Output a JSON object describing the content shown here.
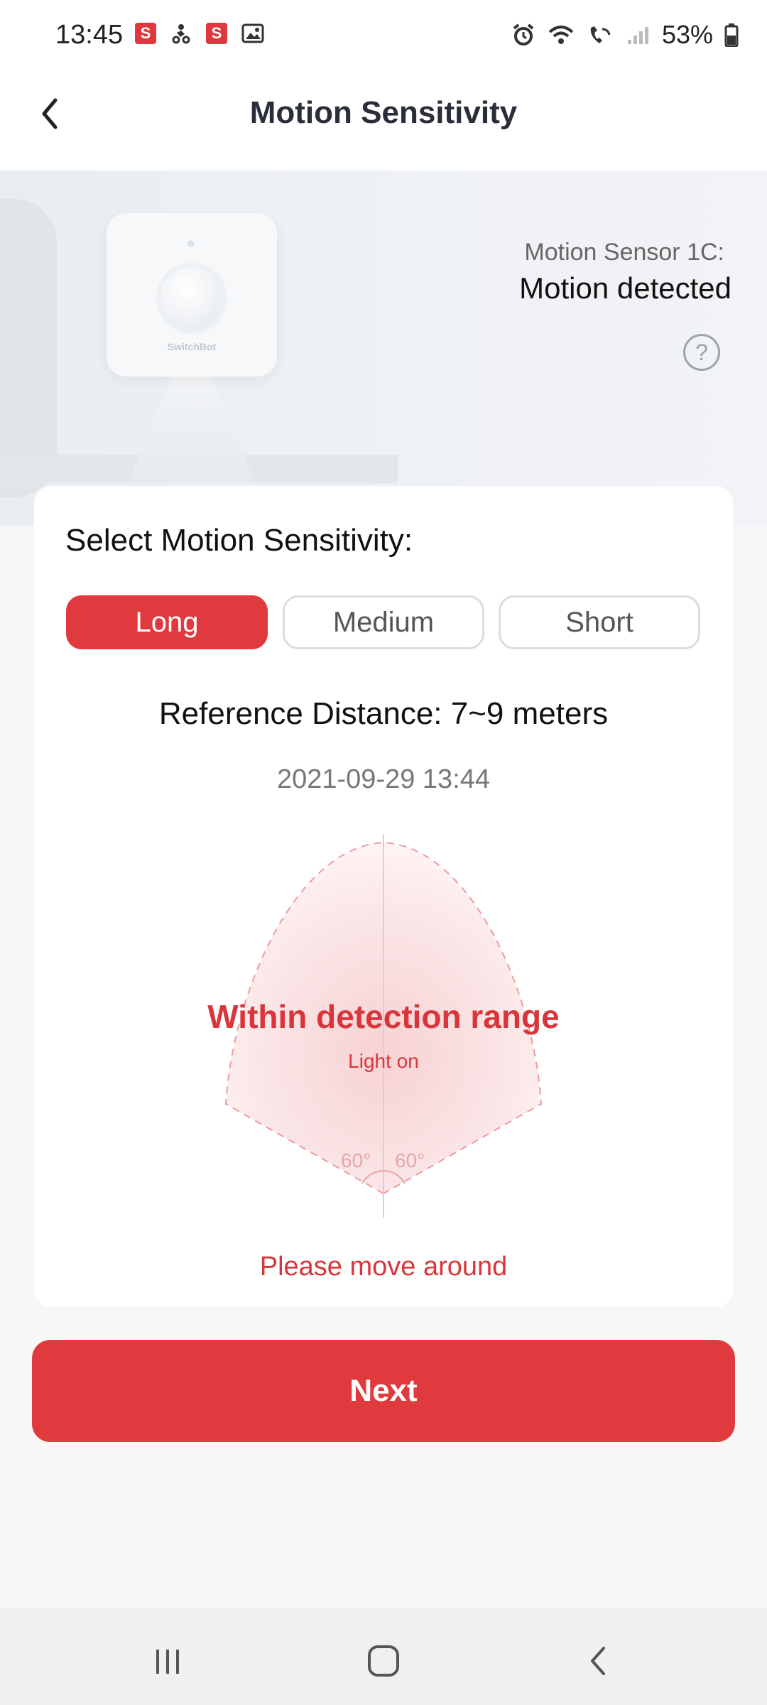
{
  "status_bar": {
    "time": "13:45",
    "left_icons": [
      "app-s-badge-icon",
      "rider-icon",
      "app-s-badge-icon",
      "gallery-icon"
    ],
    "badge_letter": "S",
    "right_icons": [
      "alarm-icon",
      "wifi-icon",
      "wifi-call-icon",
      "signal-icon",
      "battery-icon"
    ],
    "battery": "53%"
  },
  "header": {
    "title": "Motion Sensitivity",
    "back_icon": "chevron-left-icon"
  },
  "hero": {
    "device_brand": "SwitchBot",
    "sensor_name": "Motion Sensor 1C:",
    "sensor_status": "Motion detected",
    "help_icon": "question-icon",
    "help_symbol": "?"
  },
  "card": {
    "title": "Select Motion Sensitivity:",
    "options": [
      {
        "label": "Long",
        "selected": true
      },
      {
        "label": "Medium",
        "selected": false
      },
      {
        "label": "Short",
        "selected": false
      }
    ],
    "reference_distance": "Reference Distance: 7~9 meters",
    "timestamp": "2021-09-29 13:44",
    "range_title": "Within detection range",
    "range_subtitle": "Light on",
    "angle_left": "60°",
    "angle_right": "60°",
    "hint": "Please move around"
  },
  "actions": {
    "next_label": "Next"
  },
  "colors": {
    "accent": "#e13a3e",
    "text_primary": "#111111",
    "text_secondary": "#777777"
  },
  "nav_bar": {
    "items": [
      "recent-apps-icon",
      "home-icon",
      "back-icon"
    ]
  }
}
